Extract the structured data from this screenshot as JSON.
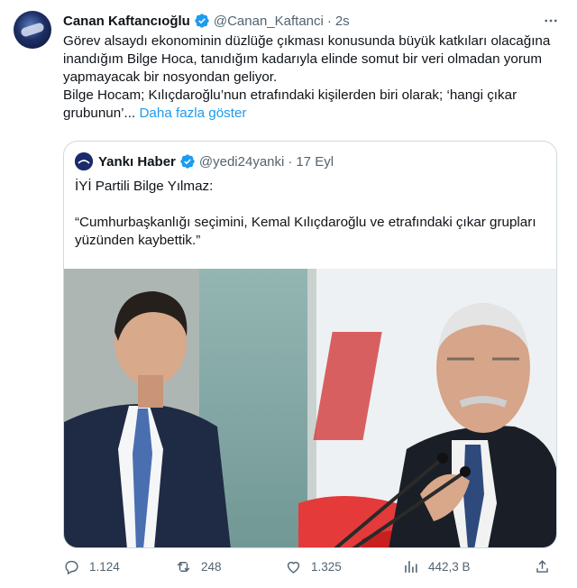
{
  "tweet": {
    "author_name": "Canan Kaftancıoğlu",
    "handle": "@Canan_Kaftanci",
    "separator": "·",
    "time": "2s",
    "more_icon": "more-horizontal-icon",
    "text_lines": [
      "Görev alsaydı ekonominin düzlüğe çıkması konusunda büyük katkıları olacağına inandığım Bilge Hoca, tanıdığım kadarıyla elinde somut bir veri olmadan yorum yapmayacak bir nosyondan geliyor.",
      "Bilge Hocam; Kılıçdaroğlu’nun etrafındaki kişilerden biri olarak; ‘hangi çıkar grubunun’..."
    ],
    "show_more": "Daha fazla göster"
  },
  "quote": {
    "author_name": "Yankı Haber",
    "handle": "@yedi24yanki",
    "separator": "·",
    "time": "17 Eyl",
    "text_lines": [
      "İYİ Partili Bilge Yılmaz:",
      "",
      "“Cumhurbaşkanlığı seçimini, Kemal Kılıçdaroğlu ve etrafındaki çıkar grupları yüzünden kaybettik.”"
    ]
  },
  "actions": {
    "reply": {
      "icon": "reply-icon",
      "count": "1.124"
    },
    "retweet": {
      "icon": "retweet-icon",
      "count": "248"
    },
    "like": {
      "icon": "like-icon",
      "count": "1.325"
    },
    "views": {
      "icon": "views-icon",
      "count": "442,3 B"
    },
    "share": {
      "icon": "share-icon"
    }
  },
  "colors": {
    "text": "#0f1419",
    "secondary": "#536471",
    "link": "#1d9bf0",
    "border": "#cfd9de",
    "verified": "#1d9bf0"
  }
}
